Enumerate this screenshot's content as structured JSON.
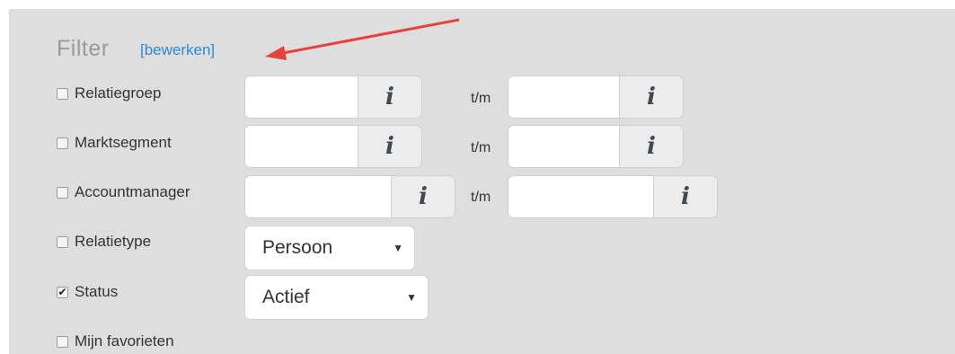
{
  "filter": {
    "title": "Filter",
    "edit_link": "[bewerken]"
  },
  "rows": [
    {
      "label": "Relatiegroep",
      "checked": false
    },
    {
      "label": "Marktsegment",
      "checked": false
    },
    {
      "label": "Accountmanager",
      "checked": false
    },
    {
      "label": "Relatietype",
      "checked": false
    },
    {
      "label": "Status",
      "checked": true
    },
    {
      "label": "Mijn favorieten",
      "checked": false
    }
  ],
  "range_separator": "t/m",
  "info_button_glyph": "i",
  "checkbox_tick": "✔",
  "selects": {
    "relatietype": "Persoon",
    "status": "Actief"
  },
  "caret_glyph": "▼",
  "annotation": {
    "color": "#e8403a"
  }
}
